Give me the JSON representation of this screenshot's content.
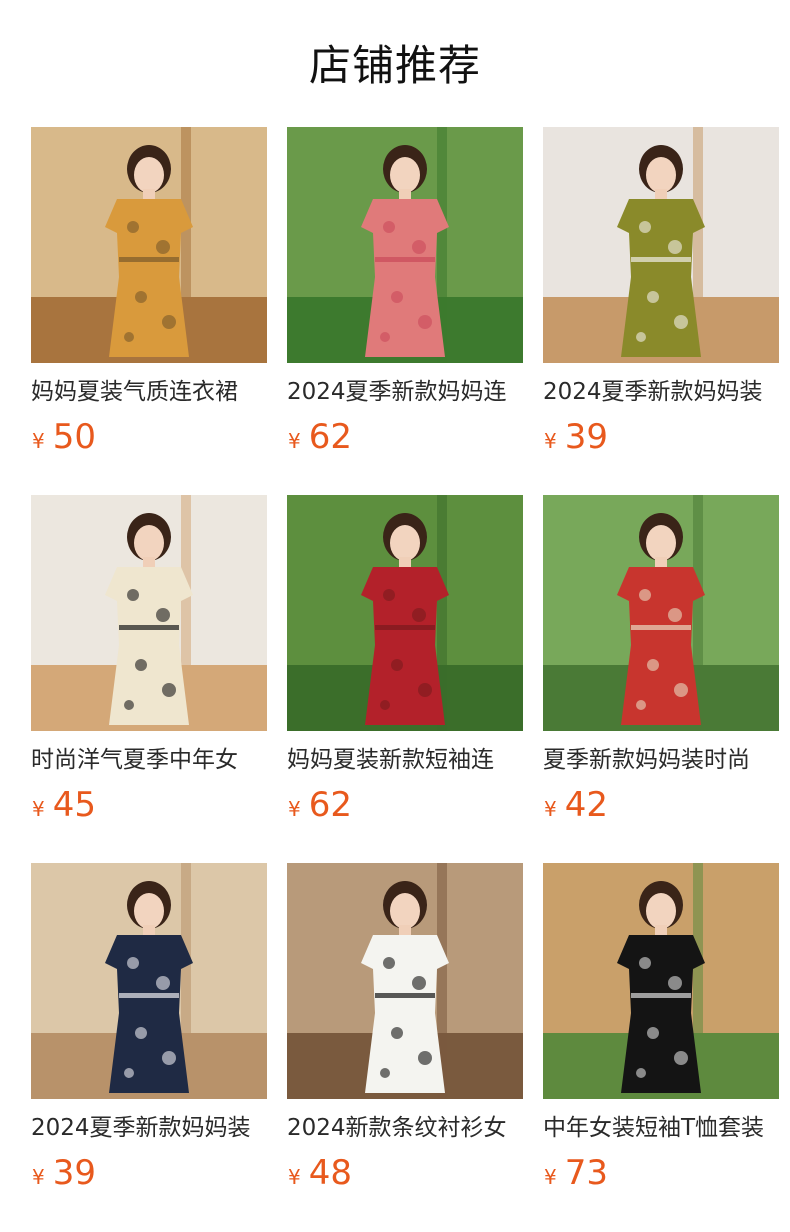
{
  "header": {
    "title": "店铺推荐"
  },
  "products": [
    {
      "name": "妈妈夏装气质连衣裙",
      "currency": "¥",
      "price": "50",
      "image": {
        "icon": "floral-dress-photo",
        "bg": "#d8b98a",
        "bg2": "#a8743e",
        "garment": "#d99a3c",
        "accent": "#7a5a2a"
      }
    },
    {
      "name": "2024夏季新款妈妈连",
      "currency": "¥",
      "price": "62",
      "image": {
        "icon": "pink-floral-dress-photo",
        "bg": "#6a9a4a",
        "bg2": "#3d7a2e",
        "garment": "#e07a7a",
        "accent": "#c94a5a"
      }
    },
    {
      "name": "2024夏季新款妈妈装",
      "currency": "¥",
      "price": "39",
      "image": {
        "icon": "olive-top-photo",
        "bg": "#e9e4df",
        "bg2": "#c79a6a",
        "garment": "#8a8a2a",
        "accent": "#f0ede6"
      }
    },
    {
      "name": "时尚洋气夏季中年女",
      "currency": "¥",
      "price": "45",
      "image": {
        "icon": "polka-dot-top-photo",
        "bg": "#ece7df",
        "bg2": "#d4a878",
        "garment": "#efe6cf",
        "accent": "#1a1a1a"
      }
    },
    {
      "name": "妈妈夏装新款短袖连",
      "currency": "¥",
      "price": "62",
      "image": {
        "icon": "red-dress-photo",
        "bg": "#5d8f3e",
        "bg2": "#3b6e2a",
        "garment": "#b3212a",
        "accent": "#7a1a1e"
      }
    },
    {
      "name": "夏季新款妈妈装时尚",
      "currency": "¥",
      "price": "42",
      "image": {
        "icon": "red-print-dress-photo",
        "bg": "#78a85a",
        "bg2": "#4a7a36",
        "garment": "#c8352e",
        "accent": "#e8d8c0"
      }
    },
    {
      "name": "2024夏季新款妈妈装",
      "currency": "¥",
      "price": "39",
      "image": {
        "icon": "striped-set-photo",
        "bg": "#dcc7a8",
        "bg2": "#b8926a",
        "garment": "#1f2a44",
        "accent": "#e8e8ec"
      }
    },
    {
      "name": "2024新款条纹衬衫女",
      "currency": "¥",
      "price": "48",
      "image": {
        "icon": "zebra-shirt-photo",
        "bg": "#b89a7a",
        "bg2": "#7a5a3e",
        "garment": "#f4f4f0",
        "accent": "#141414"
      }
    },
    {
      "name": "中年女装短袖T恤套装",
      "currency": "¥",
      "price": "73",
      "image": {
        "icon": "black-tee-skirt-photo",
        "bg": "#c9a06a",
        "bg2": "#5e8a3e",
        "garment": "#141414",
        "accent": "#d8d8d8"
      }
    }
  ]
}
